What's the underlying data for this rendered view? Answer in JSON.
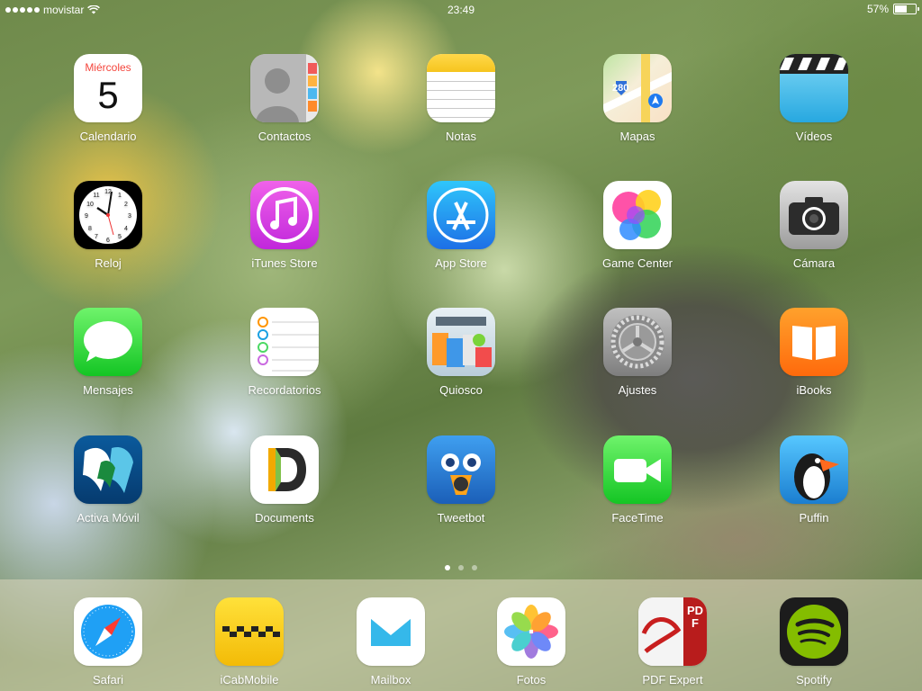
{
  "status": {
    "carrier": "movistar",
    "time": "23:49",
    "battery": "57%",
    "battery_level": 0.57,
    "signal_bars": 5
  },
  "calendar_icon": {
    "weekday": "Miércoles",
    "day": "5"
  },
  "apps": [
    {
      "label": "Calendario",
      "icon": "calendar-icon"
    },
    {
      "label": "Contactos",
      "icon": "contacts-icon"
    },
    {
      "label": "Notas",
      "icon": "notes-icon"
    },
    {
      "label": "Mapas",
      "icon": "maps-icon"
    },
    {
      "label": "Vídeos",
      "icon": "videos-icon"
    },
    {
      "label": "Reloj",
      "icon": "clock-icon"
    },
    {
      "label": "iTunes Store",
      "icon": "itunes-icon"
    },
    {
      "label": "App Store",
      "icon": "app-store-icon"
    },
    {
      "label": "Game Center",
      "icon": "game-center-icon"
    },
    {
      "label": "Cámara",
      "icon": "camera-icon"
    },
    {
      "label": "Mensajes",
      "icon": "messages-icon"
    },
    {
      "label": "Recordatorios",
      "icon": "reminders-icon"
    },
    {
      "label": "Quiosco",
      "icon": "newsstand-icon"
    },
    {
      "label": "Ajustes",
      "icon": "settings-icon"
    },
    {
      "label": "iBooks",
      "icon": "ibooks-icon"
    },
    {
      "label": "Activa Móvil",
      "icon": "activa-movil-icon"
    },
    {
      "label": "Documents",
      "icon": "documents-icon"
    },
    {
      "label": "Tweetbot",
      "icon": "tweetbot-icon"
    },
    {
      "label": "FaceTime",
      "icon": "facetime-icon"
    },
    {
      "label": "Puffin",
      "icon": "puffin-icon"
    }
  ],
  "maps_icon_text": "280",
  "pdf_icon_text": "PDF",
  "dock": [
    {
      "label": "Safari",
      "icon": "safari-icon"
    },
    {
      "label": "iCabMobile",
      "icon": "icabmobile-icon"
    },
    {
      "label": "Mailbox",
      "icon": "mailbox-icon"
    },
    {
      "label": "Fotos",
      "icon": "photos-icon"
    },
    {
      "label": "PDF Expert",
      "icon": "pdf-expert-icon"
    },
    {
      "label": "Spotify",
      "icon": "spotify-icon"
    }
  ],
  "page_indicator": {
    "pages": 3,
    "current": 1
  }
}
